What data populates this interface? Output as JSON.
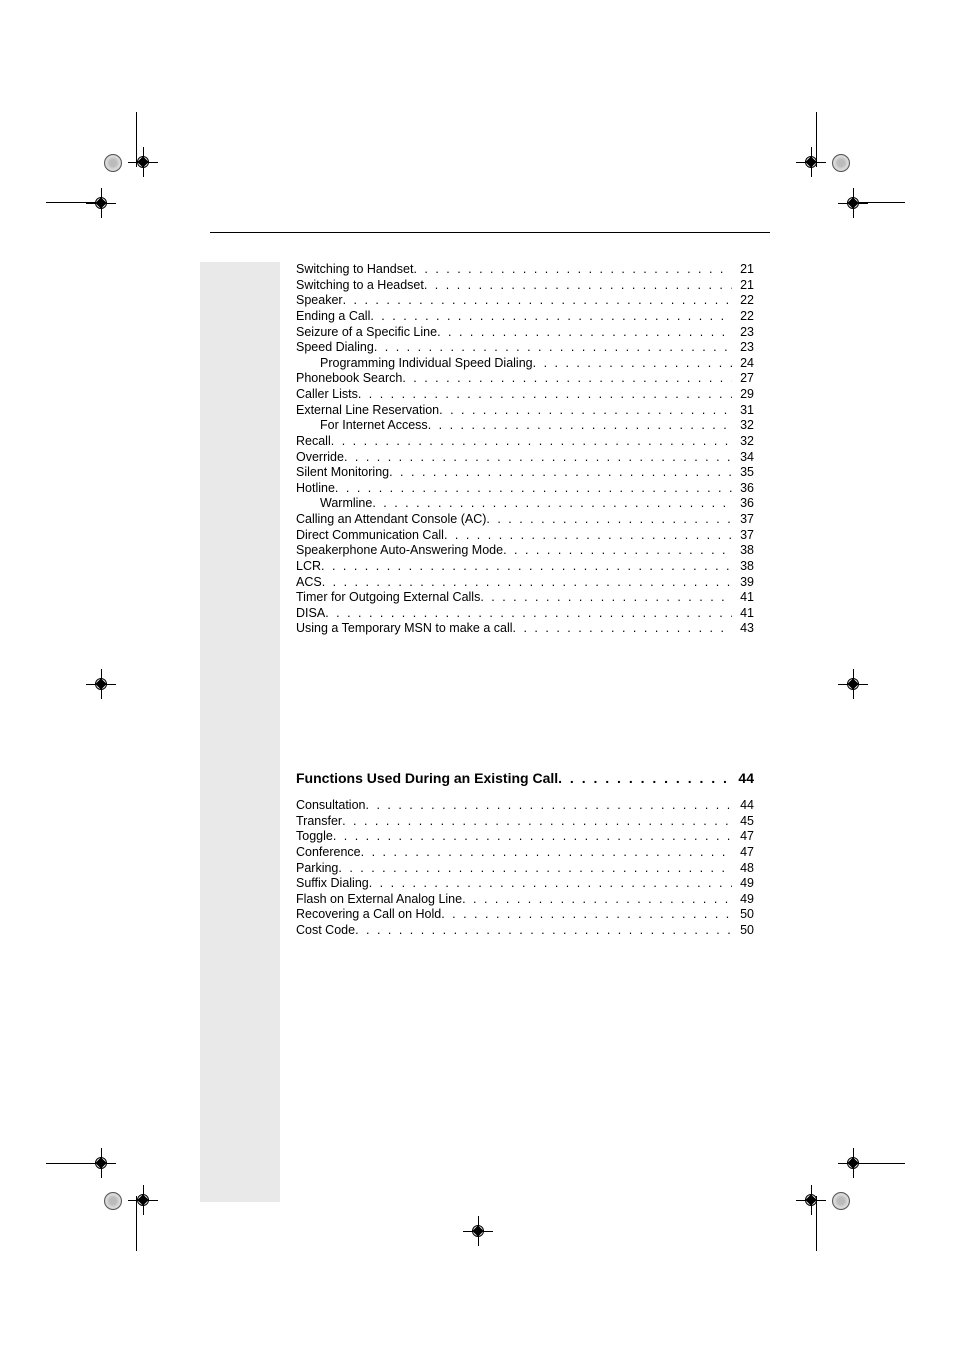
{
  "toc": {
    "section1": [
      {
        "label": "Switching to Handset",
        "page": 21,
        "indent": 0
      },
      {
        "label": "Switching to a Headset",
        "page": 21,
        "indent": 0
      },
      {
        "label": "Speaker",
        "page": 22,
        "indent": 0
      },
      {
        "label": "Ending a Call",
        "page": 22,
        "indent": 0
      },
      {
        "label": "Seizure of a Specific Line",
        "page": 23,
        "indent": 0
      },
      {
        "label": "Speed Dialing",
        "page": 23,
        "indent": 0
      },
      {
        "label": "Programming Individual Speed Dialing",
        "page": 24,
        "indent": 1
      },
      {
        "label": "Phonebook Search",
        "page": 27,
        "indent": 0
      },
      {
        "label": "Caller Lists",
        "page": 29,
        "indent": 0
      },
      {
        "label": "External Line Reservation",
        "page": 31,
        "indent": 0
      },
      {
        "label": "For Internet Access",
        "page": 32,
        "indent": 1
      },
      {
        "label": "Recall",
        "page": 32,
        "indent": 0
      },
      {
        "label": "Override",
        "page": 34,
        "indent": 0
      },
      {
        "label": "Silent Monitoring",
        "page": 35,
        "indent": 0
      },
      {
        "label": "Hotline",
        "page": 36,
        "indent": 0
      },
      {
        "label": "Warmline",
        "page": 36,
        "indent": 1
      },
      {
        "label": "Calling an Attendant Console (AC)",
        "page": 37,
        "indent": 0
      },
      {
        "label": "Direct Communication Call",
        "page": 37,
        "indent": 0
      },
      {
        "label": "Speakerphone Auto-Answering  Mode",
        "page": 38,
        "indent": 0
      },
      {
        "label": "LCR",
        "page": 38,
        "indent": 0
      },
      {
        "label": "ACS",
        "page": 39,
        "indent": 0
      },
      {
        "label": "Timer for Outgoing External Calls",
        "page": 41,
        "indent": 0
      },
      {
        "label": "DISA",
        "page": 41,
        "indent": 0
      },
      {
        "label": "Using a Temporary MSN to make a call",
        "page": 43,
        "indent": 0
      }
    ],
    "section2_title": "Functions Used During an Existing Call",
    "section2_title_page": 44,
    "section2": [
      {
        "label": "Consultation",
        "page": 44,
        "indent": 0
      },
      {
        "label": "Transfer",
        "page": 45,
        "indent": 0
      },
      {
        "label": "Toggle",
        "page": 47,
        "indent": 0
      },
      {
        "label": "Conference",
        "page": 47,
        "indent": 0
      },
      {
        "label": "Parking",
        "page": 48,
        "indent": 0
      },
      {
        "label": "Suffix Dialing",
        "page": 49,
        "indent": 0
      },
      {
        "label": "Flash on External Analog Line",
        "page": 49,
        "indent": 0
      },
      {
        "label": "Recovering a Call on Hold",
        "page": 50,
        "indent": 0
      },
      {
        "label": "Cost Code",
        "page": 50,
        "indent": 0
      }
    ]
  }
}
